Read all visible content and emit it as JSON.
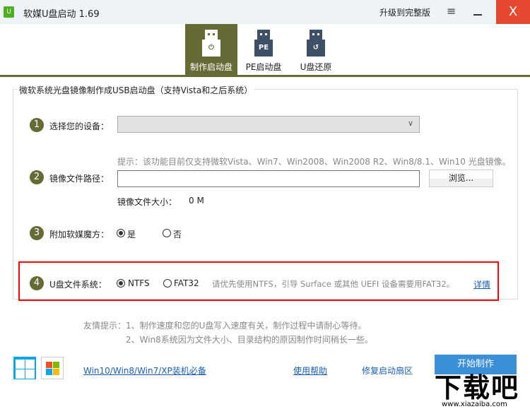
{
  "titlebar": {
    "title": "软媒U盘启动 1.69",
    "upgrade": "升级到完整版",
    "menu_icon": "≡",
    "close_icon": "X",
    "colors": {
      "bar": "#eef3f8",
      "close": "#e5492f"
    }
  },
  "tabs": [
    {
      "label": "制作启动盘",
      "icon": "usb-power",
      "active": true
    },
    {
      "label": "PE启动盘",
      "icon": "usb-pe",
      "badge": "PE"
    },
    {
      "label": "U盘还原",
      "icon": "usb-restore",
      "badge": "↺"
    }
  ],
  "accent": "#666b35",
  "group": {
    "title": "微软系统光盘镜像制作成USB启动盘（支持Vista和之后系统）"
  },
  "steps": {
    "s1": {
      "num": "1",
      "label": "选择您的设备："
    },
    "s2": {
      "num": "2",
      "label": "镜像文件路径：",
      "hint": "提示：该功能目前仅支持微软Vista、Win7、Win2008、Win2008 R2、Win8/8.1、Win10 光盘镜像。",
      "path_value": "",
      "browse": "浏览...",
      "size_label": "镜像文件大小：",
      "size_value": "0 M"
    },
    "s3": {
      "num": "3",
      "label": "附加软媒魔方：",
      "yes": "是",
      "no": "否",
      "selected": "是"
    },
    "s4": {
      "num": "4",
      "label": "U盘文件系统：",
      "ntfs": "NTFS",
      "fat32": "FAT32",
      "selected": "NTFS",
      "hint": "请优先使用NTFS，引导 Surface 或其他 UEFI 设备需要用FAT32。",
      "details": "详情"
    }
  },
  "tips": {
    "line1": "友情提示：1、制作速度和您的U盘写入速度有关，制作过程中请耐心等待。",
    "line2": "2、Win8系统因为文件大小、目录结构的原因制作时间稍长一些。"
  },
  "footer": {
    "os_link": "Win10/Win8/Win7/XP装机必备",
    "help": "使用帮助",
    "repair": "修复启动扇区",
    "start": "开始制作"
  },
  "watermark": {
    "text": "下载吧",
    "url": "www.xiazaiba.com"
  }
}
